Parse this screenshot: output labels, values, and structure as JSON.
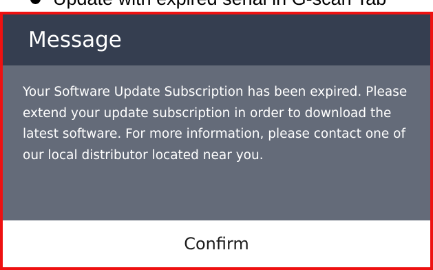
{
  "doc_heading": {
    "text": "Update with expired serial in G-scan Tab"
  },
  "dialog": {
    "title": "Message",
    "message": "Your Software Update Subscription has been expired. Please extend your update subscription in order to download the latest software. For more information, please contact one of our local distributor located near you.",
    "confirm_label": "Confirm"
  },
  "colors": {
    "highlight_border": "#ee1111",
    "header_bg": "#353e50",
    "body_bg": "#646b79",
    "button_bg": "#ffffff"
  }
}
